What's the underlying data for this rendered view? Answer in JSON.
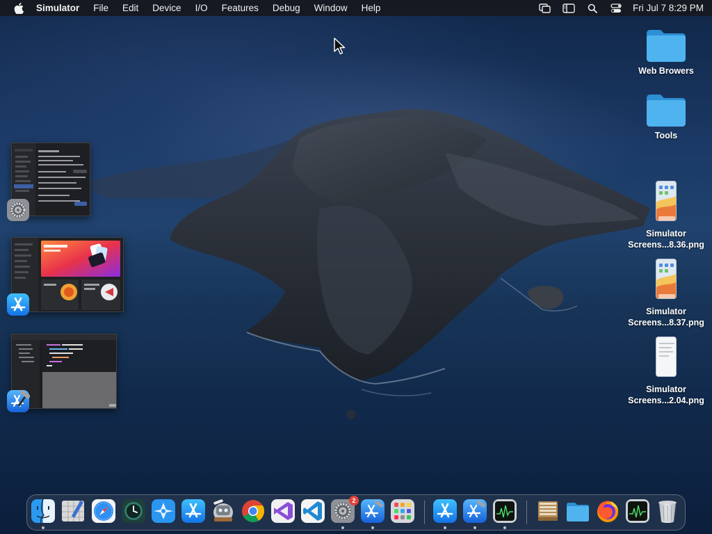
{
  "menubar": {
    "app_name": "Simulator",
    "menus": [
      "File",
      "Edit",
      "Device",
      "I/O",
      "Features",
      "Debug",
      "Window",
      "Help"
    ],
    "clock": "Fri Jul 7  8:29 PM",
    "status_icons": [
      "screen-mirroring-icon",
      "display-sidebar-icon",
      "spotlight-search-icon",
      "control-center-icon"
    ]
  },
  "desktop": {
    "icons": [
      {
        "label": "Web Browers",
        "type": "folder"
      },
      {
        "label": "Tools",
        "type": "folder"
      },
      {
        "label": "Simulator Screens...8.36.png",
        "line1": "Simulator",
        "line2": "Screens...8.36.png",
        "type": "screenshot"
      },
      {
        "label": "Simulator Screens...8.37.png",
        "line1": "Simulator",
        "line2": "Screens...8.37.png",
        "type": "screenshot"
      },
      {
        "label": "Simulator Screens...2.04.png",
        "line1": "Simulator",
        "line2": "Screens...2.04.png",
        "type": "screenshot-blank"
      }
    ]
  },
  "thumbnails": [
    {
      "app": "system-settings-icon"
    },
    {
      "app": "app-store-icon"
    },
    {
      "app": "xcode-icon"
    }
  ],
  "dock": {
    "apps": [
      "finder-icon",
      "sketch-pad-icon",
      "safari-icon",
      "time-machine-icon",
      "testflight-icon",
      "app-store-icon",
      "automator-icon",
      "chrome-icon",
      "visual-studio-icon",
      "vscode-icon",
      "system-settings-icon",
      "xcode-icon",
      "launchpad-icon",
      "app-store-recent-icon",
      "xcode-recent-icon",
      "activity-monitor-icon",
      "archive-icon",
      "folder-icon",
      "firefox-icon",
      "activity-monitor-minimized-icon",
      "trash-icon"
    ],
    "settings_badge": "2"
  },
  "colors": {
    "menubar": "#16181e",
    "folder_blue": "#3aa3e3",
    "badge_red": "#e5433a"
  }
}
